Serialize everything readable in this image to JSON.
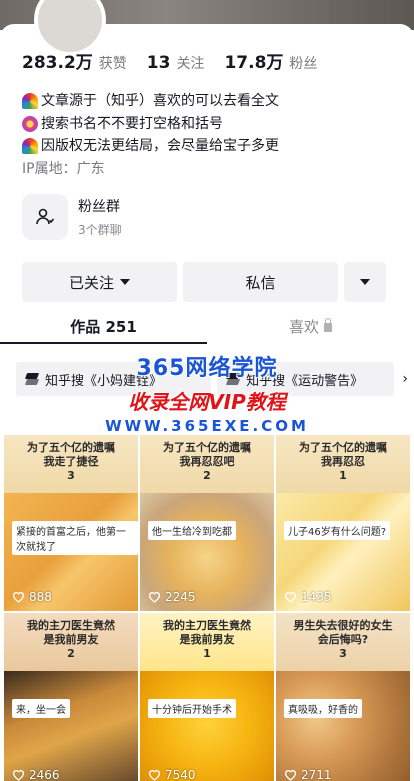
{
  "profile": {
    "stats": [
      {
        "value": "283.2万",
        "label": "获赞"
      },
      {
        "value": "13",
        "label": "关注"
      },
      {
        "value": "17.8万",
        "label": "粉丝"
      }
    ],
    "bio": [
      "文章源于（知乎）喜欢的可以去看全文",
      "搜索书名不不要打空格和括号",
      "因版权无法更结局，会尽量给宝子多更"
    ],
    "ip": "IP属地：广东"
  },
  "fans_group": {
    "title": "粉丝群",
    "subtitle": "3个群聊"
  },
  "actions": {
    "follow_label": "已关注",
    "message_label": "私信"
  },
  "tabs": {
    "works_label": "作品 251",
    "likes_label": "喜欢"
  },
  "search_strip": {
    "chip1": "知乎搜《小妈建铨》",
    "chip2": "知乎搜《运动警告》"
  },
  "watermark": {
    "line1": "365网络学院",
    "line2": "收录全网VIP教程",
    "line3": "WWW.365EXE.COM"
  },
  "videos": [
    {
      "caption1": "为了五个亿的遗嘱",
      "caption2": "我走了捷径",
      "caption3": "3",
      "sub": "紧接的首富之后，他第一次就找了",
      "likes": "888"
    },
    {
      "caption1": "为了五个亿的遗嘱",
      "caption2": "我再忍忍吧",
      "caption3": "2",
      "sub": "他一生给冷到吃都",
      "likes": "2245"
    },
    {
      "caption1": "为了五个亿的遗嘱",
      "caption2": "我再忍忍",
      "caption3": "1",
      "sub": "儿子46岁有什么问题?",
      "likes": "1435"
    },
    {
      "caption1": "我的主刀医生竟然",
      "caption2": "是我前男友",
      "caption3": "2",
      "sub": "来，坐一会",
      "likes": "2466"
    },
    {
      "caption1": "我的主刀医生竟然",
      "caption2": "是我前男友",
      "caption3": "1",
      "sub": "十分钟后开始手术",
      "likes": "7540"
    },
    {
      "caption1": "男生失去很好的女生",
      "caption2": "会后悔吗?",
      "caption3": "3",
      "sub": "真吸吸，好香的",
      "likes": "2711"
    }
  ],
  "colors": {
    "text": "#161823",
    "muted": "#7a7b80",
    "button_bg": "#f2f2f4",
    "watermark_blue": "#1a55d6",
    "watermark_red": "#e0141b"
  }
}
